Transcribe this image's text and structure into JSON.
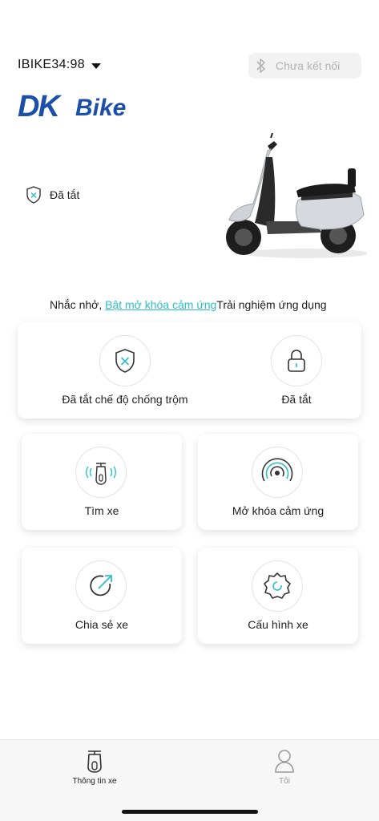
{
  "header": {
    "device_name": "IBIKE34:98",
    "connection_status": "Chưa kết nối"
  },
  "brand": {
    "logo_text_1": "DK",
    "logo_text_2": "Bike",
    "logo_color": "#1c4fa8"
  },
  "vehicle": {
    "status_label": "Đã tắt"
  },
  "reminder": {
    "prefix": "Nhắc nhở,",
    "link_text": "Bật mở khóa cảm ứng",
    "suffix": "Trải nghiệm ứng dụng"
  },
  "controls": {
    "anti_theft_label": "Đã tắt chế độ chống trộm",
    "lock_label": "Đã tắt"
  },
  "actions": {
    "find_bike": "Tìm xe",
    "touch_unlock": "Mở khóa cảm ứng",
    "share_bike": "Chia sẻ xe",
    "bike_config": "Cấu hình xe"
  },
  "tabs": [
    {
      "label": "Thông tin xe",
      "active": true
    },
    {
      "label": "Tôi",
      "active": false
    }
  ],
  "colors": {
    "accent": "#2bbfc6",
    "logo": "#1c4fa8"
  }
}
